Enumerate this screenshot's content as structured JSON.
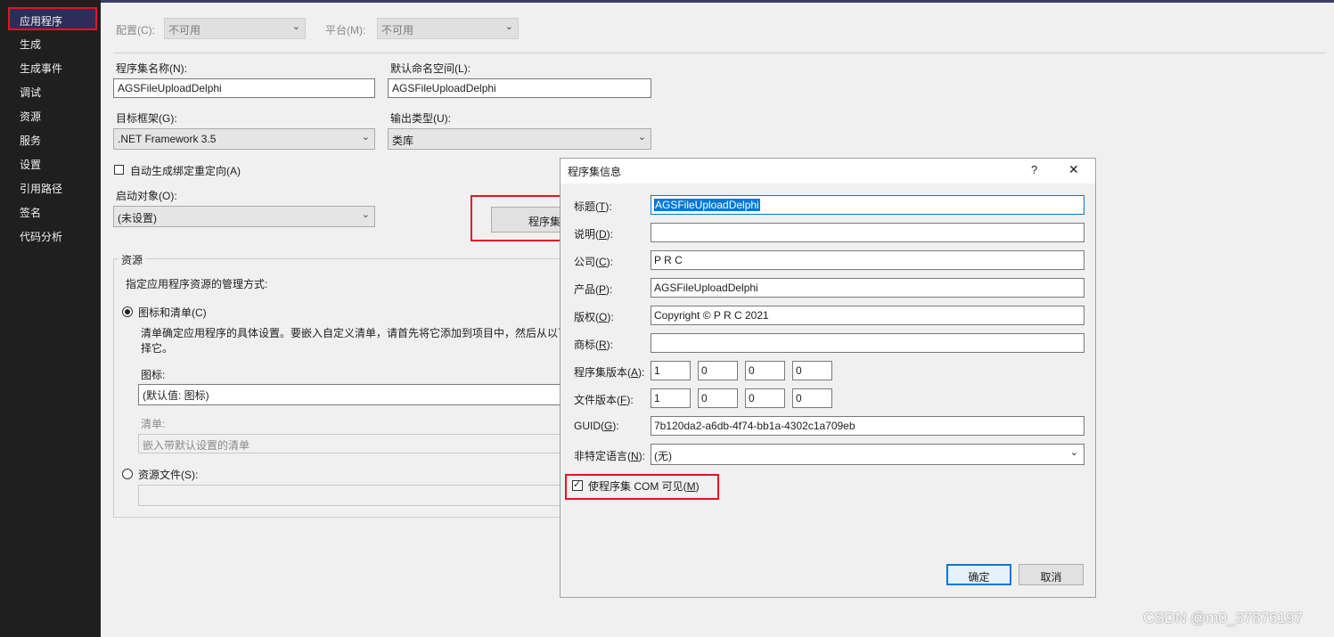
{
  "sidebar": {
    "items": [
      {
        "label": "应用程序"
      },
      {
        "label": "生成"
      },
      {
        "label": "生成事件"
      },
      {
        "label": "调试"
      },
      {
        "label": "资源"
      },
      {
        "label": "服务"
      },
      {
        "label": "设置"
      },
      {
        "label": "引用路径"
      },
      {
        "label": "签名"
      },
      {
        "label": "代码分析"
      }
    ]
  },
  "config": {
    "config_label": "配置(C):",
    "config_value": "不可用",
    "platform_label": "平台(M):",
    "platform_value": "不可用"
  },
  "app": {
    "assembly_name_label": "程序集名称(N):",
    "assembly_name": "AGSFileUploadDelphi",
    "namespace_label": "默认命名空间(L):",
    "namespace": "AGSFileUploadDelphi",
    "framework_label": "目标框架(G):",
    "framework": ".NET Framework 3.5",
    "output_type_label": "输出类型(U):",
    "output_type": "类库",
    "auto_binding_label": "自动生成绑定重定向(A)",
    "startup_label": "启动对象(O):",
    "startup_value": "(未设置)",
    "assembly_info_button": "程序集"
  },
  "resources": {
    "group_label": "资源",
    "desc": "指定应用程序资源的管理方式:",
    "icon_manifest_option": "图标和清单(C)",
    "manifest_desc_1": "清单确定应用程序的具体设置。要嵌入自定义清单，请首先将它添加到项目中，然后从以下",
    "manifest_desc_2": "择它。",
    "icon_label": "图标:",
    "icon_value": "(默认值: 图标)",
    "manifest_label": "清单:",
    "manifest_value": "嵌入带默认设置的清单",
    "resource_file_option": "资源文件(S):"
  },
  "dialog": {
    "title": "程序集信息",
    "help": "?",
    "close": "✕",
    "title_label": [
      "标题(",
      "T",
      "):"
    ],
    "title_value": "AGSFileUploadDelphi",
    "desc_label": [
      "说明(",
      "D",
      "):"
    ],
    "desc_value": "",
    "company_label": [
      "公司(",
      "C",
      "):"
    ],
    "company_value": "P R C",
    "product_label": [
      "产品(",
      "P",
      "):"
    ],
    "product_value": "AGSFileUploadDelphi",
    "copyright_label": [
      "版权(",
      "O",
      "):"
    ],
    "copyright_value": "Copyright © P R C 2021",
    "trademark_label": [
      "商标(",
      "R",
      "):"
    ],
    "trademark_value": "",
    "assembly_version_label": [
      "程序集版本(",
      "A",
      "):"
    ],
    "assembly_version": [
      "1",
      "0",
      "0",
      "0"
    ],
    "file_version_label": [
      "文件版本(",
      "F",
      "):"
    ],
    "file_version": [
      "1",
      "0",
      "0",
      "0"
    ],
    "guid_label": [
      "GUID(",
      "G",
      "):"
    ],
    "guid_value": "7b120da2-a6db-4f74-bb1a-4302c1a709eb",
    "neutral_lang_label": [
      "非特定语言(",
      "N",
      "):"
    ],
    "neutral_lang_value": "(无)",
    "com_visible_label": [
      "使程序集 COM 可见(",
      "M",
      ")"
    ],
    "ok": "确定",
    "cancel": "取消"
  },
  "watermark": "CSDN @m0_37876197"
}
